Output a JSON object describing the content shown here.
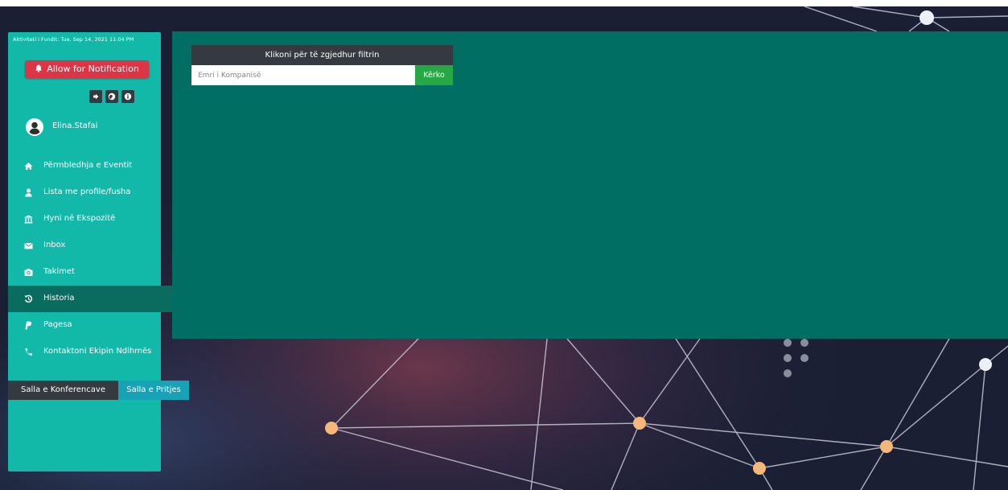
{
  "sidebar": {
    "last_activity": "Aktiviteti i Fundit: Tue, Sep 14, 2021 11:04 PM",
    "notification_button": "Allow for Notification",
    "user_name": "Elina.Stafai",
    "icon_buttons": [
      "logout-icon",
      "globe-icon",
      "info-icon"
    ],
    "nav": [
      {
        "label": "Përmbledhja e Eventit",
        "icon": "home-icon"
      },
      {
        "label": "Lista me profile/fusha",
        "icon": "user-icon"
      },
      {
        "label": "Hyni në Ekspozitë",
        "icon": "bank-icon"
      },
      {
        "label": "Inbox",
        "icon": "envelope-icon"
      },
      {
        "label": "Takimet",
        "icon": "camera-icon"
      },
      {
        "label": "Historia",
        "icon": "history-icon",
        "active": true
      },
      {
        "label": "Pagesa",
        "icon": "paypal-icon"
      },
      {
        "label": "Kontaktoni Ekipin Ndihmës",
        "icon": "phone-icon"
      }
    ],
    "room_conference": "Salla e Konferencave",
    "room_waiting": "Salla e Pritjes"
  },
  "filter": {
    "header": "Klikoni për të zgjedhur filtrin",
    "input_value": "",
    "input_placeholder": "Emri i Kompanisë",
    "search_button": "Kërko"
  },
  "colors": {
    "sidebar": "#13b9a8",
    "sidebar_active": "#0a6b5f",
    "main_panel": "#006e62",
    "notification": "#dc3545",
    "search": "#28a745",
    "waiting_room": "#17a2b8",
    "dark": "#343a40"
  }
}
